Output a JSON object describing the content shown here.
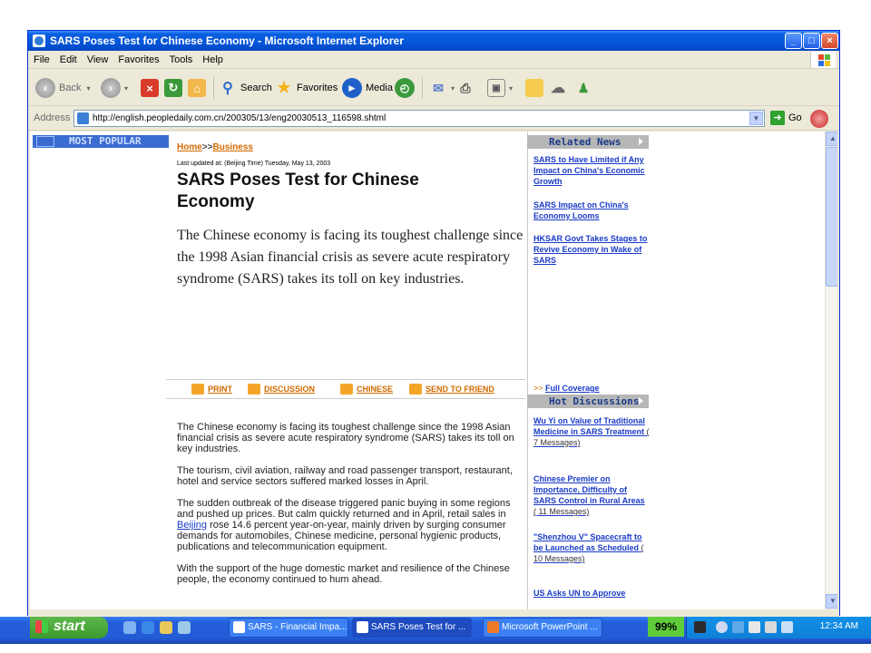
{
  "window": {
    "title": "SARS Poses Test for Chinese Economy - Microsoft Internet Explorer"
  },
  "menu": [
    "File",
    "Edit",
    "View",
    "Favorites",
    "Tools",
    "Help"
  ],
  "toolbar": {
    "back": "Back",
    "search": "Search",
    "favorites": "Favorites",
    "media": "Media"
  },
  "address": {
    "label": "Address",
    "url": "http://english.peopledaily.com.cn/200305/13/eng20030513_116598.shtml",
    "go": "Go"
  },
  "page": {
    "most_popular": "MOST POPULAR",
    "breadcrumb": {
      "home": "Home",
      "separator": ">>",
      "section": "Business"
    },
    "updated": "Last updated at: (Beijing Time) Tuesday, May 13, 2003",
    "headline": "SARS Poses Test for Chinese Economy",
    "lede": "The Chinese economy is facing its toughest challenge since the 1998 Asian financial crisis as severe acute respiratory syndrome (SARS) takes its toll on key industries.",
    "tools": [
      "PRINT",
      "DISCUSSION",
      "CHINESE",
      "SEND TO FRIEND"
    ],
    "paragraphs": {
      "p1": "The Chinese economy is facing its toughest challenge since the 1998 Asian financial crisis as severe acute respiratory syndrome (SARS) takes its toll on key industries.",
      "p2": "The tourism, civil aviation, railway and road passenger transport, restaurant, hotel and service sectors suffered marked losses in April.",
      "p3a": "The sudden outbreak of the disease triggered panic buying in some regions and pushed up prices. But calm quickly returned and in April, retail sales in ",
      "p3link": "Beijing",
      "p3b": " rose 14.6 percent year-on-year, mainly driven by surging consumer demands for automobiles, Chinese medicine, personal hygienic products, publications and telecommunication equipment.",
      "p4": "With the support of the huge domestic market and resilience of the Chinese people, the economy continued to hum ahead."
    }
  },
  "related": {
    "heading": "Related News",
    "items": [
      "SARS to Have Limited if Any Impact on China's Economic Growth",
      "SARS Impact on China's Economy Looms",
      "HKSAR Govt Takes Stages to Revive Economy in Wake of SARS"
    ],
    "full_prefix": ">>",
    "full_link": "Full Coverage"
  },
  "hot": {
    "heading": "Hot Discussions",
    "items": [
      {
        "title": "Wu Yi on Value of Traditional Medicine in SARS Treatment",
        "msgs": "( 7 Messages)"
      },
      {
        "title": "Chinese Premier on Importance, Difficulty of SARS Control in Rural Areas",
        "msgs": "( 11 Messages)"
      },
      {
        "title": "\"Shenzhou V\" Spacecraft to be Launched as Scheduled",
        "msgs": "( 10 Messages)"
      },
      {
        "title": "US Asks UN to Approve",
        "msgs": ""
      }
    ]
  },
  "taskbar": {
    "start": "start",
    "tasks": [
      "SARS - Financial Impa...",
      "SARS Poses Test for ...",
      "Microsoft PowerPoint ..."
    ],
    "battery": "99%",
    "clock": "12:34 AM"
  },
  "colors": {
    "link_blue": "#1a3ac8",
    "link_orange": "#d06a00",
    "xp_blue": "#0556d9"
  }
}
